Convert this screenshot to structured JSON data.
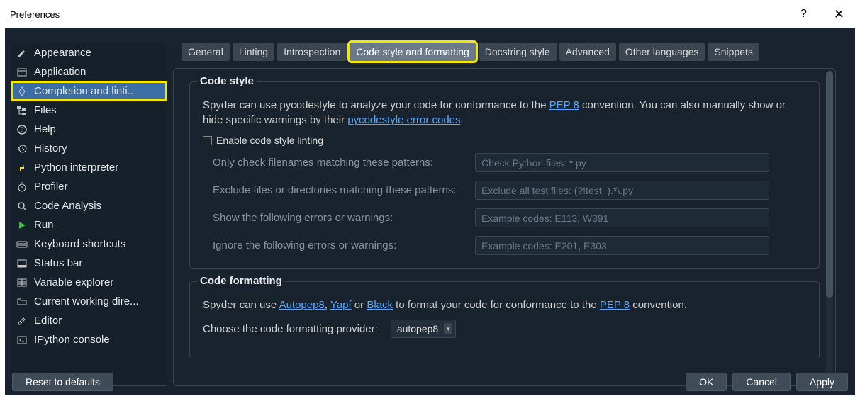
{
  "window": {
    "title": "Preferences"
  },
  "sidebar": {
    "items": [
      {
        "label": "Appearance",
        "icon": "brush-icon"
      },
      {
        "label": "Application",
        "icon": "window-icon"
      },
      {
        "label": "Completion and linti...",
        "icon": "diamond-icon",
        "selected": true,
        "highlighted": true
      },
      {
        "label": "Files",
        "icon": "folder-tree-icon"
      },
      {
        "label": "Help",
        "icon": "help-icon"
      },
      {
        "label": "History",
        "icon": "history-icon"
      },
      {
        "label": "Python interpreter",
        "icon": "python-icon"
      },
      {
        "label": "Profiler",
        "icon": "stopwatch-icon"
      },
      {
        "label": "Code Analysis",
        "icon": "magnify-icon"
      },
      {
        "label": "Run",
        "icon": "play-icon"
      },
      {
        "label": "Keyboard shortcuts",
        "icon": "keyboard-icon"
      },
      {
        "label": "Status bar",
        "icon": "statusbar-icon"
      },
      {
        "label": "Variable explorer",
        "icon": "table-icon"
      },
      {
        "label": "Current working dire...",
        "icon": "folder-icon"
      },
      {
        "label": "Editor",
        "icon": "edit-icon"
      },
      {
        "label": "IPython console",
        "icon": "terminal-icon"
      }
    ]
  },
  "tabs": [
    {
      "label": "General"
    },
    {
      "label": "Linting"
    },
    {
      "label": "Introspection"
    },
    {
      "label": "Code style and formatting",
      "active": true,
      "highlighted": true
    },
    {
      "label": "Docstring style"
    },
    {
      "label": "Advanced"
    },
    {
      "label": "Other languages"
    },
    {
      "label": "Snippets"
    }
  ],
  "code_style": {
    "title": "Code style",
    "desc1": "Spyder can use pycodestyle to analyze your code for conformance to the ",
    "pep8": "PEP 8",
    "desc2": " convention. You can also manually show or hide specific warnings by their ",
    "codes_link": "pycodestyle error codes",
    "desc3": ".",
    "enable_label": "Enable code style linting",
    "f1_label": "Only check filenames matching these patterns:",
    "f1_placeholder": "Check Python files: *.py",
    "f2_label": "Exclude files or directories matching these patterns:",
    "f2_placeholder": "Exclude all test files: (?!test_).*\\.py",
    "f3_label": "Show the following errors or warnings:",
    "f3_placeholder": "Example codes: E113, W391",
    "f4_label": "Ignore the following errors or warnings:",
    "f4_placeholder": "Example codes: E201, E303"
  },
  "code_formatting": {
    "title": "Code formatting",
    "d1": "Spyder can use ",
    "autopep8": "Autopep8",
    "comma": ", ",
    "yapf": "Yapf",
    "or": " or ",
    "black": "Black",
    "d2": " to format your code for conformance to the ",
    "pep8": "PEP 8",
    "d3": " convention.",
    "choose_label": "Choose the code formatting provider:",
    "choose_value": "autopep8"
  },
  "footer": {
    "reset": "Reset to defaults",
    "ok": "OK",
    "cancel": "Cancel",
    "apply": "Apply"
  }
}
